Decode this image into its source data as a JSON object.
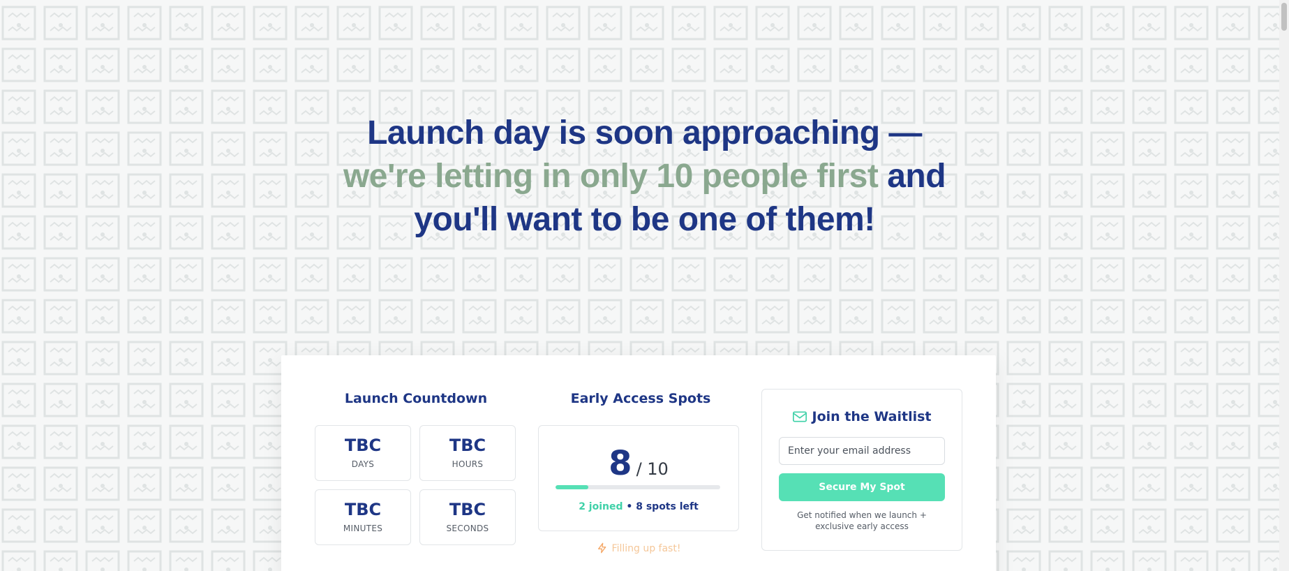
{
  "headline": {
    "line1": "Launch day is soon approaching —",
    "line2_accent": "we're letting in only 10 people first",
    "line2_rest": " and",
    "line3": "you'll want to be one of them!"
  },
  "countdown": {
    "title": "Launch Countdown",
    "tiles": [
      {
        "value": "TBC",
        "unit": "DAYS"
      },
      {
        "value": "TBC",
        "unit": "HOURS"
      },
      {
        "value": "TBC",
        "unit": "MINUTES"
      },
      {
        "value": "TBC",
        "unit": "SECONDS"
      }
    ]
  },
  "spots": {
    "title": "Early Access Spots",
    "remaining": "8",
    "total": "/ 10",
    "progress_fraction": 0.2,
    "joined_text": "2 joined",
    "separator": " • ",
    "left_text": "8 spots left",
    "filling_text": "Filling up fast!"
  },
  "waitlist": {
    "title": "Join the Waitlist",
    "email_placeholder": "Enter your email address",
    "button_label": "Secure My Spot",
    "note": "Get notified when we launch + exclusive early access"
  },
  "icons": {
    "mail": "mail-icon",
    "bolt": "lightning-icon"
  },
  "colors": {
    "primary": "#1e3685",
    "accent": "#8aa88f",
    "button": "#56e0b5",
    "joined": "#3fd1a8",
    "warning": "#f5c799"
  }
}
